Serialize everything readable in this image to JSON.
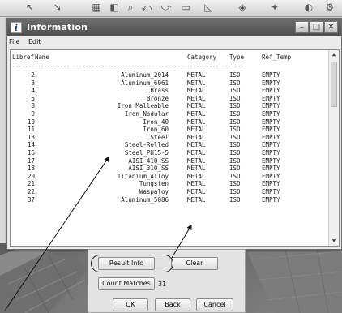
{
  "toolbar": {
    "icons": [
      "selection-arrow-icon",
      "tool-icon",
      "grid-icon",
      "view-icon",
      "rotate-icon",
      "pan-icon",
      "screen-icon",
      "perspective-icon"
    ]
  },
  "window": {
    "title": "Information",
    "app_icon_letter": "i",
    "menu": [
      "File",
      "Edit"
    ]
  },
  "table": {
    "columns": [
      "Libref",
      "Name",
      "Category",
      "Type",
      "Ref_Temp"
    ],
    "rows": [
      {
        "libref": "2",
        "name": "Aluminum_2014",
        "category": "METAL",
        "type": "ISO",
        "ref_temp": "EMPTY"
      },
      {
        "libref": "3",
        "name": "Aluminum_6061",
        "category": "METAL",
        "type": "ISO",
        "ref_temp": "EMPTY"
      },
      {
        "libref": "4",
        "name": "Brass",
        "category": "METAL",
        "type": "ISO",
        "ref_temp": "EMPTY"
      },
      {
        "libref": "5",
        "name": "Bronze",
        "category": "METAL",
        "type": "ISO",
        "ref_temp": "EMPTY"
      },
      {
        "libref": "8",
        "name": "Iron_Malleable",
        "category": "METAL",
        "type": "ISO",
        "ref_temp": "EMPTY"
      },
      {
        "libref": "9",
        "name": "Iron_Nodular",
        "category": "METAL",
        "type": "ISO",
        "ref_temp": "EMPTY"
      },
      {
        "libref": "10",
        "name": "Iron_40",
        "category": "METAL",
        "type": "ISO",
        "ref_temp": "EMPTY"
      },
      {
        "libref": "11",
        "name": "Iron_60",
        "category": "METAL",
        "type": "ISO",
        "ref_temp": "EMPTY"
      },
      {
        "libref": "13",
        "name": "Steel",
        "category": "METAL",
        "type": "ISO",
        "ref_temp": "EMPTY"
      },
      {
        "libref": "14",
        "name": "Steel-Rolled",
        "category": "METAL",
        "type": "ISO",
        "ref_temp": "EMPTY"
      },
      {
        "libref": "16",
        "name": "Steel_PH15-5",
        "category": "METAL",
        "type": "ISO",
        "ref_temp": "EMPTY"
      },
      {
        "libref": "17",
        "name": "AISI_410_SS",
        "category": "METAL",
        "type": "ISO",
        "ref_temp": "EMPTY"
      },
      {
        "libref": "18",
        "name": "AISI_310_SS",
        "category": "METAL",
        "type": "ISO",
        "ref_temp": "EMPTY"
      },
      {
        "libref": "20",
        "name": "Titanium_Alloy",
        "category": "METAL",
        "type": "ISO",
        "ref_temp": "EMPTY"
      },
      {
        "libref": "21",
        "name": "Tungsten",
        "category": "METAL",
        "type": "ISO",
        "ref_temp": "EMPTY"
      },
      {
        "libref": "22",
        "name": "Waspaloy",
        "category": "METAL",
        "type": "ISO",
        "ref_temp": "EMPTY"
      },
      {
        "libref": "37",
        "name": "Aluminum_5086",
        "category": "METAL",
        "type": "ISO",
        "ref_temp": "EMPTY"
      }
    ]
  },
  "panel": {
    "result_info_label": "Result Info",
    "clear_label": "Clear",
    "count_matches_label": "Count Matches",
    "count_value": "31",
    "ok_label": "OK",
    "back_label": "Back",
    "cancel_label": "Cancel"
  }
}
